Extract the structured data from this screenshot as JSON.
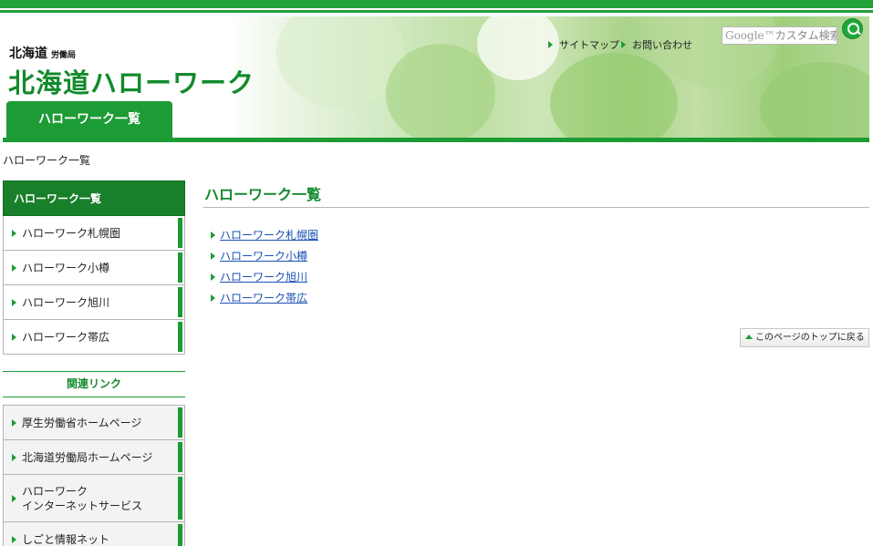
{
  "header": {
    "subtitle": "北海道",
    "subtitle_small": "労働局",
    "title": "北海道ハローワーク",
    "tab_label": "ハローワーク一覧",
    "util_links": [
      "サイトマップ",
      "お問い合わせ"
    ],
    "search": {
      "google_label": "Google™",
      "placeholder": "カスタム検索"
    }
  },
  "breadcrumb": "ハローワーク一覧",
  "sidebar": {
    "heading": "ハローワーク一覧",
    "items": [
      {
        "label": "ハローワーク札幌圏"
      },
      {
        "label": "ハローワーク小樽"
      },
      {
        "label": "ハローワーク旭川"
      },
      {
        "label": "ハローワーク帯広"
      }
    ]
  },
  "related": {
    "heading": "関連リンク",
    "items": [
      {
        "label": "厚生労働省ホームページ"
      },
      {
        "label": "北海道労働局ホームページ"
      },
      {
        "label_line1": "ハローワーク",
        "label_line2": "インターネットサービス"
      },
      {
        "label": "しごと情報ネット"
      }
    ]
  },
  "main": {
    "heading": "ハローワーク一覧",
    "links": [
      {
        "label": "ハローワーク札幌圏"
      },
      {
        "label": "ハローワーク小樽"
      },
      {
        "label": "ハローワーク旭川"
      },
      {
        "label": "ハローワーク帯広"
      }
    ],
    "pagetop_label": "このページのトップに戻る"
  },
  "colors": {
    "brand_green": "#1d9b35",
    "dark_green": "#187f2a",
    "link_blue": "#1a4fb4"
  }
}
